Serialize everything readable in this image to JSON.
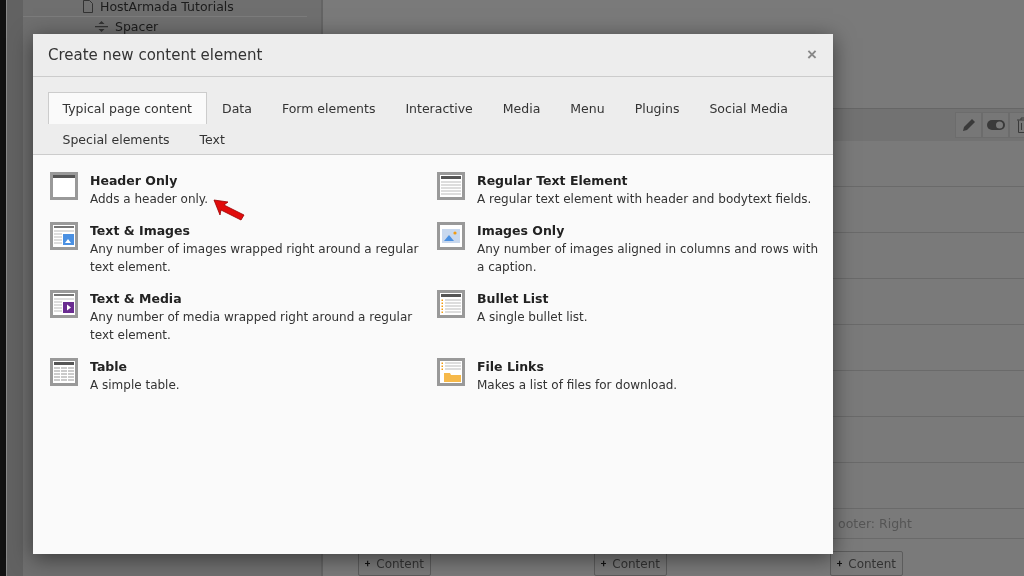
{
  "background": {
    "page_tree": [
      {
        "label": "HostArmada Tutorials",
        "kind": "page"
      },
      {
        "label": "Spacer",
        "kind": "spacer"
      }
    ],
    "column_label": "ooter: Right",
    "add_buttons": [
      "Content",
      "Content",
      "Content"
    ]
  },
  "dialog": {
    "title": "Create new content element",
    "close": "×",
    "tabs": [
      {
        "label": "Typical page content",
        "selected": true
      },
      {
        "label": "Data",
        "selected": false
      },
      {
        "label": "Form elements",
        "selected": false
      },
      {
        "label": "Interactive",
        "selected": false
      },
      {
        "label": "Media",
        "selected": false
      },
      {
        "label": "Menu",
        "selected": false
      },
      {
        "label": "Plugins",
        "selected": false
      },
      {
        "label": "Social Media",
        "selected": false
      },
      {
        "label": "Special elements",
        "selected": false
      },
      {
        "label": "Text",
        "selected": false
      }
    ],
    "items": [
      {
        "kind": "header",
        "title": "Header Only",
        "description": "Adds a header only."
      },
      {
        "kind": "text",
        "title": "Regular Text Element",
        "description": "A regular text element with header and bodytext fields."
      },
      {
        "kind": "textpic",
        "title": "Text & Images",
        "description": "Any number of images wrapped right around a regular text element."
      },
      {
        "kind": "images",
        "title": "Images Only",
        "description": "Any number of images aligned in columns and rows with a caption."
      },
      {
        "kind": "textmedia",
        "title": "Text & Media",
        "description": "Any number of media wrapped right around a regular text element."
      },
      {
        "kind": "bullets",
        "title": "Bullet List",
        "description": "A single bullet list."
      },
      {
        "kind": "table",
        "title": "Table",
        "description": "A simple table."
      },
      {
        "kind": "files",
        "title": "File Links",
        "description": "Makes a list of files for download."
      }
    ]
  }
}
